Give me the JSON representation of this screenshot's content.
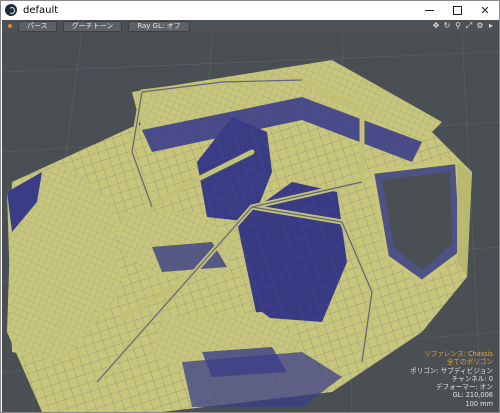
{
  "window": {
    "title": "default",
    "controls": {
      "minimize": "",
      "maximize": "",
      "close": "✕"
    }
  },
  "viewport": {
    "toolbar": {
      "view_label": "パース",
      "shading_label": "グーチトーン",
      "ray_label": "Ray GL: オフ",
      "icons": {
        "move": "✥",
        "rotate": "↻",
        "zoom": "⚲",
        "maximize": "⤢",
        "settings": "⚙",
        "menu": "▸"
      }
    },
    "info": {
      "reference": "リファレンス: Chassis",
      "polygons": "全てのポリゴン",
      "polygon_type": "ポリゴン: サブディビジョン",
      "channels": "チャンネル: 0",
      "deformer": "デフォーマー: オン",
      "gl": "GL: 210,006",
      "scale": "100 mm"
    },
    "colors": {
      "background": "#4a4f53",
      "mesh_fill": "#c7c67a",
      "mesh_shadow": "#373a86",
      "wire": "#5a5a8a",
      "accent": "#e2a43a"
    }
  }
}
